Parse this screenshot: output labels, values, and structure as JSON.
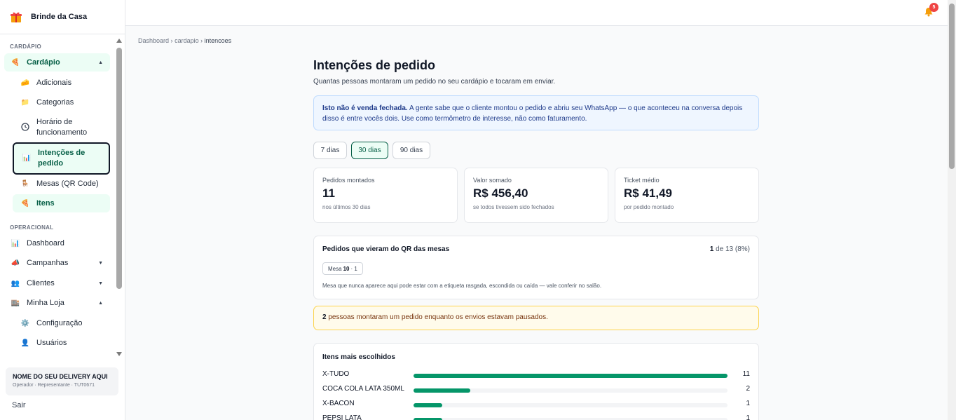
{
  "brand": {
    "name": "Brinde da Casa"
  },
  "sidebar": {
    "section_cardapio": "CARDÁPIO",
    "section_operacional": "OPERACIONAL",
    "cardapio": "Cardápio",
    "adicionais": "Adicionais",
    "categorias": "Categorias",
    "horario_1": "Horário de",
    "horario_2": "funcionamento",
    "intencoes_1": "Intenções de",
    "intencoes_2": "pedido",
    "mesas": "Mesas (QR Code)",
    "itens": "Itens",
    "dashboard": "Dashboard",
    "campanhas": "Campanhas",
    "clientes": "Clientes",
    "minha_loja": "Minha Loja",
    "configuracao": "Configuração",
    "usuarios": "Usuários"
  },
  "store": {
    "name": "NOME DO SEU DELIVERY AQUI",
    "sub": "Operador · Representante · TUT0671"
  },
  "logout": "Sair",
  "topbar": {
    "notifications": "5"
  },
  "breadcrumb": {
    "b1": "Dashboard",
    "sep": "›",
    "b2": "cardapio",
    "b3": "intencoes"
  },
  "page": {
    "title": "Intenções de pedido",
    "subtitle": "Quantas pessoas montaram um pedido no seu cardápio e tocaram em enviar."
  },
  "info": {
    "bold": "Isto não é venda fechada.",
    "text": " A gente sabe que o cliente montou o pedido e abriu seu WhatsApp — o que aconteceu na conversa depois disso é entre vocês dois. Use como termômetro de interesse, não como faturamento."
  },
  "ranges": {
    "r7": "7 dias",
    "r30": "30 dias",
    "r90": "90 dias"
  },
  "stats": {
    "s1": {
      "label": "Pedidos montados",
      "value": "11",
      "sub": "nos últimos 30 dias"
    },
    "s2": {
      "label": "Valor somado",
      "value": "R$ 456,40",
      "sub": "se todos tivessem sido fechados"
    },
    "s3": {
      "label": "Ticket médio",
      "value": "R$ 41,49",
      "sub": "por pedido montado"
    }
  },
  "qr": {
    "title": "Pedidos que vieram do QR das mesas",
    "count": "1",
    "ratio_rest": " de 13 (8%)",
    "chip_prefix": "Mesa ",
    "chip_mesa": "10",
    "chip_suffix": " · 1",
    "note": "Mesa que nunca aparece aqui pode estar com a etiqueta rasgada, escondida ou caída — vale conferir no salão."
  },
  "warn": {
    "count": "2",
    "text": " pessoas montaram um pedido enquanto os envios estavam pausados."
  },
  "items": {
    "title": "Itens mais escolhidos",
    "max": 11,
    "rows": [
      {
        "name": "X-TUDO",
        "count": "11",
        "value": 11
      },
      {
        "name": "COCA COLA LATA 350ML",
        "count": "2",
        "value": 2
      },
      {
        "name": "X-BACON",
        "count": "1",
        "value": 1
      },
      {
        "name": "PEPSI LATA",
        "count": "1",
        "value": 1
      }
    ]
  },
  "colors": {
    "accent": "#059669",
    "accent_bg": "#ecfdf5",
    "accent_text": "#065f46"
  }
}
